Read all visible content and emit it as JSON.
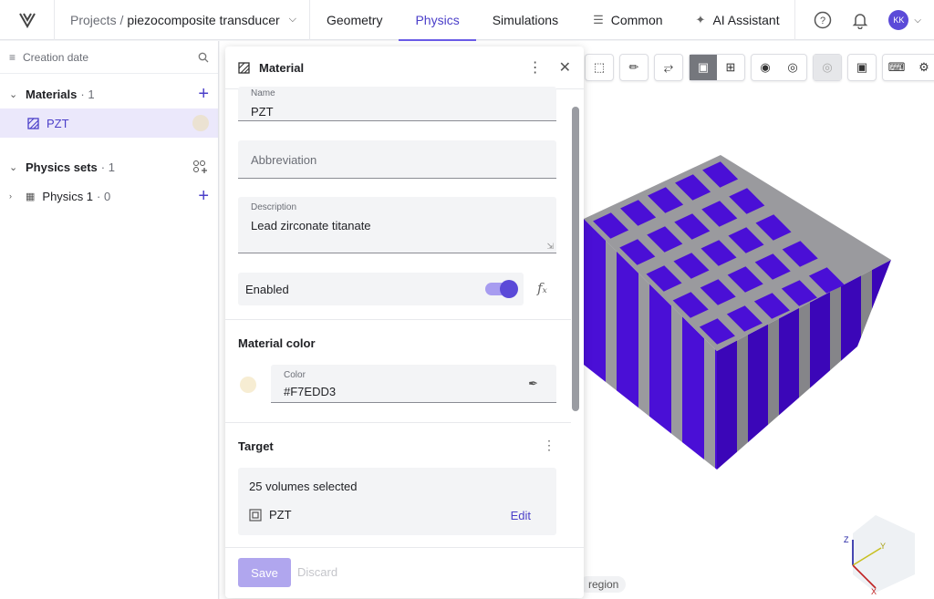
{
  "header": {
    "breadcrumb_prefix": "Projects /",
    "project_name": "piezocomposite transducer",
    "tabs": [
      {
        "label": "Geometry"
      },
      {
        "label": "Physics"
      },
      {
        "label": "Simulations"
      },
      {
        "label": "Common"
      },
      {
        "label": "AI Assistant"
      }
    ],
    "active_tab": "Physics",
    "avatar_initials": "KK"
  },
  "sidebar": {
    "sort_label": "Creation date",
    "materials": {
      "label": "Materials",
      "count": "· 1",
      "items": [
        {
          "label": "PZT"
        }
      ]
    },
    "physics_sets": {
      "label": "Physics sets",
      "count": "· 1",
      "items": [
        {
          "label": "Physics 1",
          "count": "· 0"
        }
      ]
    }
  },
  "panel": {
    "title": "Material",
    "name_label": "Name",
    "name_value": "PZT",
    "abbreviation_placeholder": "Abbreviation",
    "description_label": "Description",
    "description_value": "Lead zirconate titanate",
    "enabled_label": "Enabled",
    "enabled": true,
    "material_color_title": "Material color",
    "color_label": "Color",
    "color_value": "#F7EDD3",
    "target_title": "Target",
    "target_selection": "25 volumes selected",
    "target_item": "PZT",
    "edit_label": "Edit",
    "save_label": "Save",
    "discard_label": "Discard"
  },
  "viewport": {
    "region_chip": "region",
    "axis_labels": [
      "Z",
      "Y",
      "X"
    ]
  },
  "colors": {
    "accent": "#5b4ad8",
    "volume_fill": "#4a0fd6",
    "matrix_fill": "#9a9a9e"
  }
}
